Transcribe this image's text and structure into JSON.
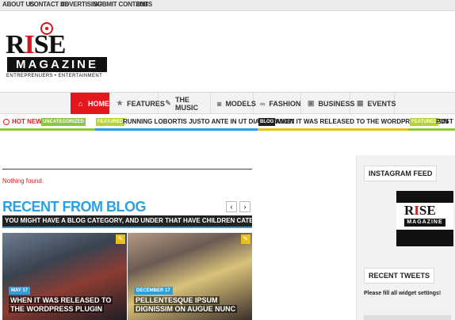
{
  "topbar": {
    "links": [
      "ABOUT US",
      "CONTACT US",
      "ADVERTISING",
      "SUBMIT CONTENT",
      "JOBS"
    ]
  },
  "logo": {
    "word_r": "R",
    "word_i": "I",
    "word_se": "SE",
    "magazine": "MAGAZINE",
    "tagline": "ENTREPRENUERS • ENTERTAINMENT"
  },
  "nav": {
    "items": [
      {
        "label": "HOME",
        "icon": "home-icon",
        "glyph": "⌂"
      },
      {
        "label": "FEATURES",
        "icon": "star-icon",
        "glyph": "★"
      },
      {
        "label": "THE MUSIC",
        "icon": "microphone-icon",
        "glyph": "✎"
      },
      {
        "label": "MODELS",
        "icon": "camera-icon",
        "glyph": "◙"
      },
      {
        "label": "FASHION",
        "icon": "glasses-icon",
        "glyph": "∞"
      },
      {
        "label": "BUSINESS",
        "icon": "briefcase-icon",
        "glyph": "▣"
      },
      {
        "label": "EVENTS",
        "icon": "calendar-icon",
        "glyph": "▦"
      }
    ],
    "active_color": "#e5171e"
  },
  "hotnews": {
    "label": "HOT NEWS",
    "items": [
      {
        "tag": "UNCATEGORIZED",
        "tag_color": "#8cc63f",
        "text": ""
      },
      {
        "tag": "FEATURED",
        "tag_color": "#b5d334",
        "text": "RUNNING LOBORTIS JUSTO ANTE IN UT DIAM BLANDIT"
      },
      {
        "tag": "BLOG",
        "tag_color": "#222222",
        "text": "WHEN IT WAS RELEASED TO THE WORDPRESS PLUGIN"
      },
      {
        "tag": "FEATURED",
        "tag_color": "#b5d334",
        "text": "POST WI"
      }
    ]
  },
  "main": {
    "nothing_found": "Nothing found."
  },
  "blog": {
    "title": "RECENT FROM BLOG",
    "subtitle": "YOU MIGHT HAVE A BLOG CATEGORY, AND UNDER THAT HAVE CHILDREN CATEGORIES",
    "prev": "‹",
    "next": "›",
    "accent": "#2aa0e0",
    "cards": [
      {
        "date": "MAY 17",
        "title": "WHEN IT WAS RELEASED TO THE WORDPRESS PLUGIN"
      },
      {
        "date": "DECEMBER 17",
        "title": "PELLENTESQUE IPSUM DIGNISSIM ON AUGUE NUNC"
      }
    ]
  },
  "sidebar": {
    "instagram_title": "INSTAGRAM FEED",
    "instagram_logo_r": "R",
    "instagram_logo_i": "I",
    "instagram_logo_se": "SE",
    "instagram_logo_mag": "MAGAZINE",
    "tweets_title": "RECENT TWEETS",
    "tweets_note": "Please fill all widget settings!"
  }
}
